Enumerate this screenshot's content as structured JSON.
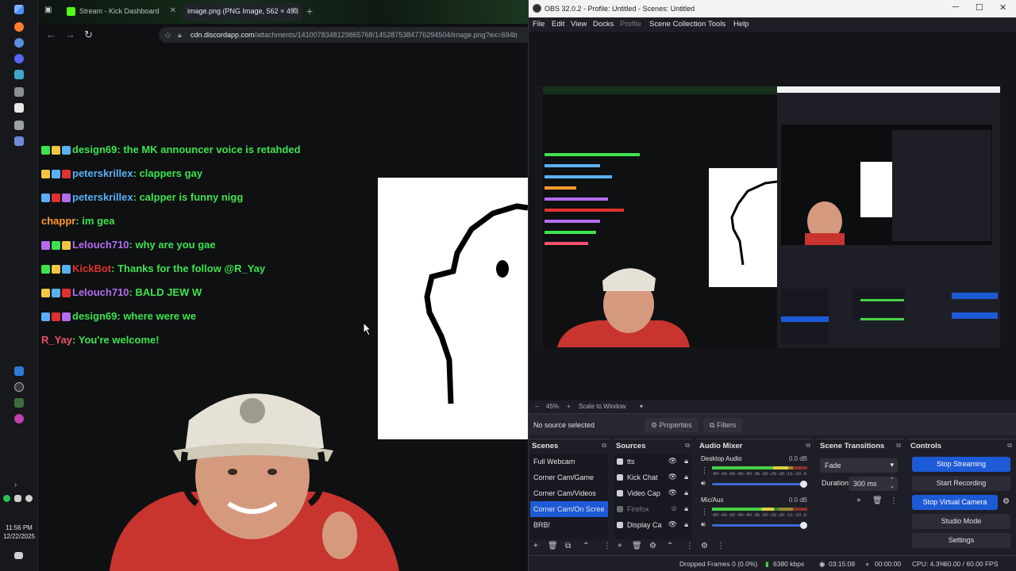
{
  "taskbar": {
    "clock_time": "11:56 PM",
    "clock_date": "12/22/2025"
  },
  "browser": {
    "tabs": [
      {
        "label": "Stream - Kick Dashboard"
      },
      {
        "label": "image.png (PNG Image, 562 × 493"
      }
    ],
    "url_host": "cdn.discordapp.com",
    "url_path": "/attachments/1410078348129865768/1452875384776294504/image.png?ex=694b"
  },
  "chat": {
    "messages": [
      {
        "user": "design69",
        "text": "the MK announcer voice is retahded",
        "color": "#3ee34e"
      },
      {
        "user": "peterskrillex",
        "text": "clappers gay",
        "color": "#5ab0f5"
      },
      {
        "user": "peterskrillex",
        "text": "calpper is funny nigg",
        "color": "#5ab0f5"
      },
      {
        "user": "chappr",
        "text": "im gea",
        "color": "#ff9a2e"
      },
      {
        "user": "Lelouch710",
        "text": "why are you gae",
        "color": "#b46cf0"
      },
      {
        "user": "KickBot",
        "text": "Thanks for the follow @R_Yay",
        "color": "#e0312f"
      },
      {
        "user": "Lelouch710",
        "text": "BALD JEW W",
        "color": "#b46cf0"
      },
      {
        "user": "design69",
        "text": "where were we",
        "color": "#3ee34e"
      },
      {
        "user": "R_Yay",
        "text": "You're welcome!",
        "color": "#f0506e"
      }
    ]
  },
  "obs": {
    "title": "OBS 32.0.2 - Profile: Untitled - Scenes: Untitled",
    "menu": [
      "File",
      "Edit",
      "View",
      "Docks",
      "Profile",
      "Scene Collection",
      "Tools",
      "Help"
    ],
    "zoom": "45%",
    "zoom_mode": "Scale to Window",
    "no_source": "No source selected",
    "properties_label": "Properties",
    "filters_label": "Filters",
    "scenes": {
      "title": "Scenes",
      "items": [
        "Full Webcam",
        "Corner Cam/Game",
        "Corner Cam/Videos",
        "Corner Cam/On Scree",
        "BRB!"
      ],
      "selected_index": 3
    },
    "sources": {
      "title": "Sources",
      "items": [
        "tts",
        "Kick Chat",
        "Video Cap",
        "Firefox",
        "Display Ca"
      ]
    },
    "mixer": {
      "title": "Audio Mixer",
      "channels": [
        {
          "name": "Desktop Audio",
          "db": "0.0 dB",
          "level": 0.8
        },
        {
          "name": "Mic/Aux",
          "db": "0.0 dB",
          "level": 0.65
        }
      ],
      "ticks": "-60 -55 -50 -45 -40 -35 -30 -25 -20 -15 -10 -5 0"
    },
    "transitions": {
      "title": "Scene Transitions",
      "type": "Fade",
      "duration_label": "Duration",
      "duration": "300 ms"
    },
    "controls": {
      "title": "Controls",
      "buttons": [
        "Stop Streaming",
        "Start Recording",
        "Stop Virtual Camera",
        "Studio Mode",
        "Settings"
      ]
    },
    "status": {
      "dropped": "Dropped Frames 0 (0.0%)",
      "bitrate": "6380 kbps",
      "stream_time": "03:15:08",
      "rec_time": "00:00:00",
      "cpu": "CPU: 4.3%",
      "fps": "60.00 / 60.00 FPS"
    }
  }
}
